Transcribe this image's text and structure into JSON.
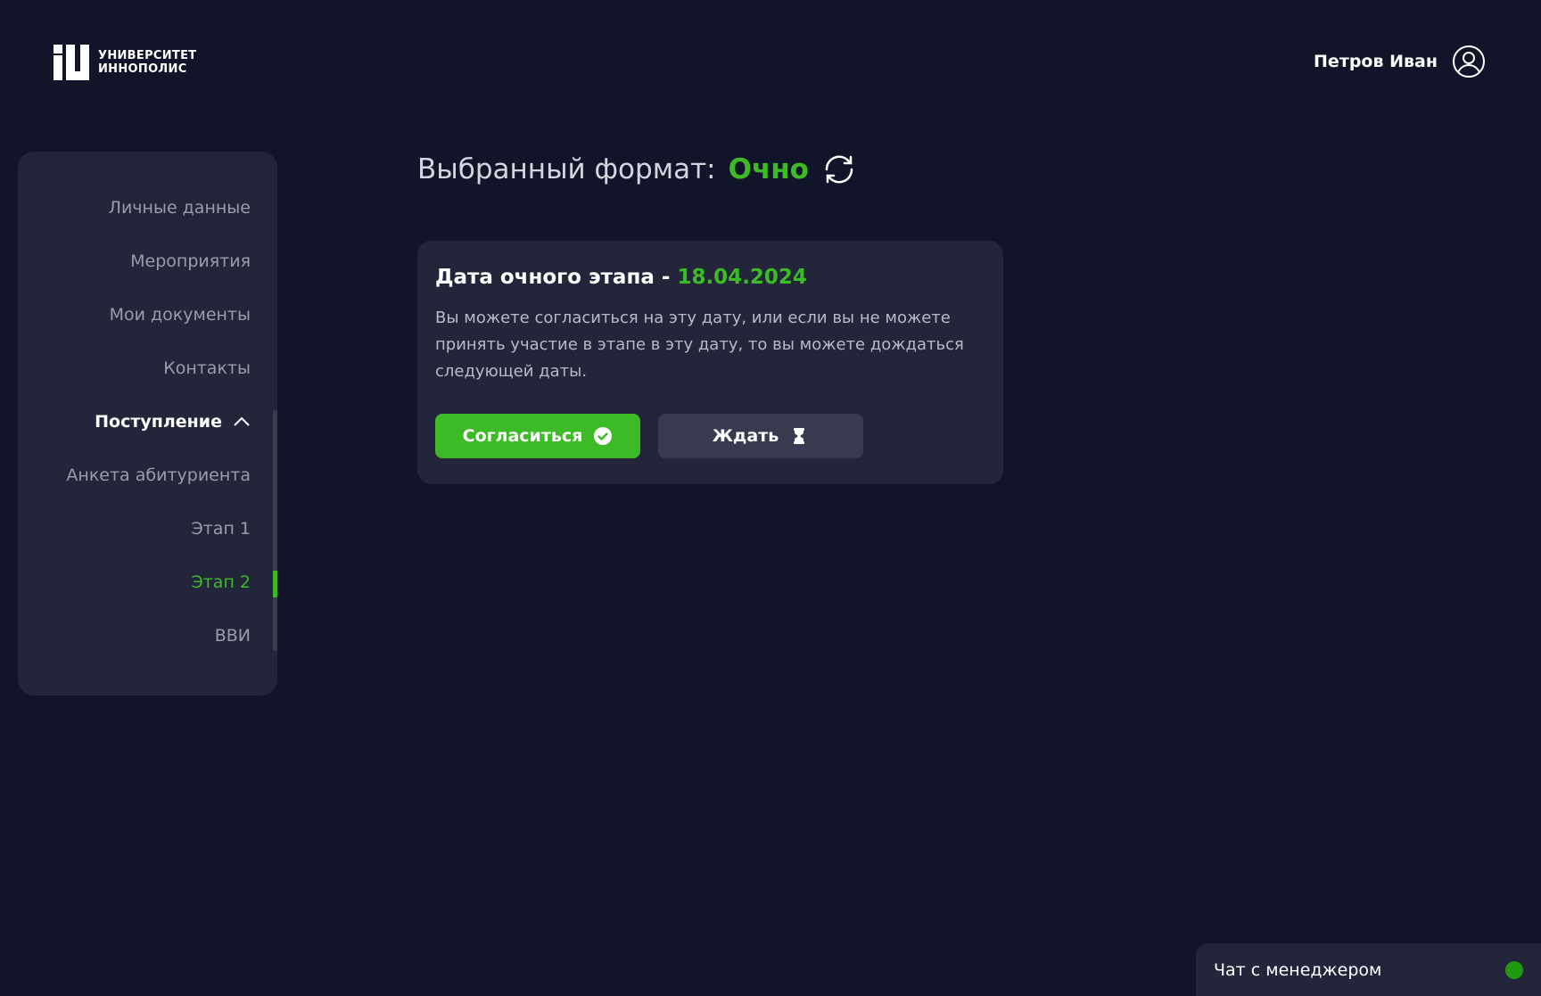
{
  "header": {
    "logo_line1": "УНИВЕРСИТЕТ",
    "logo_line2": "ИННОПОЛИС",
    "user_name": "Петров Иван",
    "user_icon": "user-circle-icon"
  },
  "sidebar": {
    "items": [
      {
        "label": "Личные данные",
        "state": "default"
      },
      {
        "label": "Мероприятия",
        "state": "default"
      },
      {
        "label": "Мои документы",
        "state": "default"
      },
      {
        "label": "Контакты",
        "state": "default"
      },
      {
        "label": "Поступление",
        "state": "expanded",
        "icon": "chevron-up-icon"
      },
      {
        "label": "Анкета абитуриента",
        "state": "default"
      },
      {
        "label": "Этап 1",
        "state": "default"
      },
      {
        "label": "Этап 2",
        "state": "active"
      },
      {
        "label": "ВВИ",
        "state": "default"
      }
    ]
  },
  "main": {
    "format_label": "Выбранный формат:",
    "format_value": "Очно",
    "format_icon": "refresh-icon",
    "card": {
      "title_prefix": "Дата очного этапа - ",
      "date": "18.04.2024",
      "text": "Вы можете согласиться на эту дату, или если вы не можете принять участие в этапе в эту дату, то вы можете дождаться следующей даты.",
      "agree_label": "Согласиться",
      "agree_icon": "check-circle-icon",
      "wait_label": "Ждать",
      "wait_icon": "hourglass-icon"
    }
  },
  "chat": {
    "label": "Чат с менеджером",
    "status": "online"
  },
  "colors": {
    "background": "#12152a",
    "panel": "#23263a",
    "accent": "#3dbb26",
    "muted_text": "#9a9ca8"
  }
}
